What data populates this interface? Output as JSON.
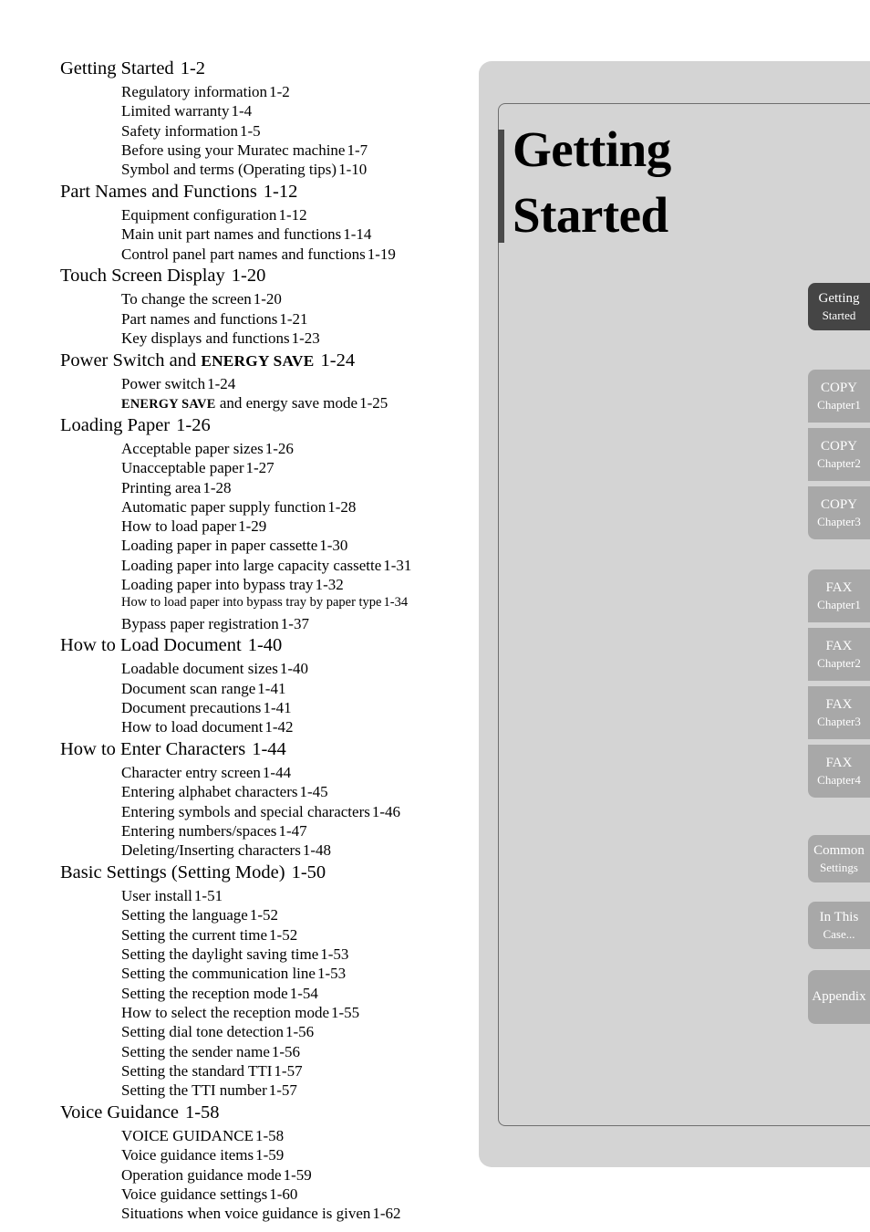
{
  "chapter": {
    "title_line1": "Getting",
    "title_line2": "Started",
    "accent_color": "#4a4a4a",
    "panel_color": "#d4d4d4"
  },
  "tabs": {
    "active_color": "#454545",
    "normal_color": "#a8a8a8",
    "groups": [
      {
        "name": "getting-started",
        "items": [
          {
            "main": "Getting",
            "sub": "Started",
            "active": true
          }
        ]
      },
      {
        "name": "copy",
        "items": [
          {
            "main": "COPY",
            "sub": "Chapter1",
            "active": false
          },
          {
            "main": "COPY",
            "sub": "Chapter2",
            "active": false
          },
          {
            "main": "COPY",
            "sub": "Chapter3",
            "active": false
          }
        ]
      },
      {
        "name": "fax",
        "items": [
          {
            "main": "FAX",
            "sub": "Chapter1",
            "active": false
          },
          {
            "main": "FAX",
            "sub": "Chapter2",
            "active": false
          },
          {
            "main": "FAX",
            "sub": "Chapter3",
            "active": false
          },
          {
            "main": "FAX",
            "sub": "Chapter4",
            "active": false
          }
        ]
      },
      {
        "name": "common-settings",
        "items": [
          {
            "main": "Common",
            "sub": "Settings",
            "active": false
          }
        ]
      },
      {
        "name": "in-this-case",
        "items": [
          {
            "main": "In This",
            "sub": "Case...",
            "active": false
          }
        ]
      },
      {
        "name": "appendix",
        "items": [
          {
            "main": "Appendix",
            "sub": "",
            "active": false
          }
        ]
      }
    ]
  },
  "toc": {
    "entries": [
      {
        "level": 1,
        "label": "Getting Started",
        "page": "1-2"
      },
      {
        "level": 2,
        "label": "Regulatory information",
        "page": "1-2"
      },
      {
        "level": 2,
        "label": "Limited warranty",
        "page": "1-4"
      },
      {
        "level": 2,
        "label": "Safety information",
        "page": "1-5"
      },
      {
        "level": 2,
        "label": "Before using your Muratec machine",
        "page": "1-7"
      },
      {
        "level": 2,
        "label": "Symbol and terms (Operating tips)",
        "page": "1-10"
      },
      {
        "level": 1,
        "label": "Part Names and Functions",
        "page": "1-12"
      },
      {
        "level": 2,
        "label": "Equipment configuration",
        "page": "1-12"
      },
      {
        "level": 2,
        "label": "Main unit part names and functions",
        "page": "1-14"
      },
      {
        "level": 2,
        "label": "Control panel part names and functions",
        "page": "1-19"
      },
      {
        "level": 1,
        "label": "Touch Screen Display",
        "page": "1-20"
      },
      {
        "level": 2,
        "label": "To change the screen",
        "page": "1-20"
      },
      {
        "level": 2,
        "label": "Part names and functions",
        "page": "1-21"
      },
      {
        "level": 2,
        "label": "Key displays and functions",
        "page": "1-23"
      },
      {
        "level": 1,
        "label": "Power Switch and ",
        "label_sc": "ENERGY SAVE",
        "page": "1-24"
      },
      {
        "level": 2,
        "label": "Power switch",
        "page": "1-24"
      },
      {
        "level": 2,
        "label_sc_first": "ENERGY SAVE",
        "label": " and energy save mode",
        "page": "1-25"
      },
      {
        "level": 1,
        "label": "Loading Paper",
        "page": "1-26"
      },
      {
        "level": 2,
        "label": "Acceptable paper sizes",
        "page": "1-26"
      },
      {
        "level": 2,
        "label": "Unacceptable paper",
        "page": "1-27"
      },
      {
        "level": 2,
        "label": "Printing area",
        "page": "1-28"
      },
      {
        "level": 2,
        "label": "Automatic paper supply function",
        "page": "1-28"
      },
      {
        "level": 2,
        "label": "How to load paper",
        "page": "1-29"
      },
      {
        "level": 2,
        "label": "Loading paper in paper cassette",
        "page": "1-30"
      },
      {
        "level": 2,
        "label": "Loading paper into large capacity cassette",
        "page": "1-31"
      },
      {
        "level": 2,
        "label": "Loading paper into bypass tray",
        "page": "1-32"
      },
      {
        "level": 2,
        "small": true,
        "label": "How to load paper into bypass tray by paper type",
        "page": "1-34"
      },
      {
        "level": 2,
        "label": "Bypass paper registration",
        "page": "1-37"
      },
      {
        "level": 1,
        "label": "How to Load Document",
        "page": "1-40"
      },
      {
        "level": 2,
        "label": "Loadable document sizes",
        "page": "1-40"
      },
      {
        "level": 2,
        "label": "Document scan range",
        "page": "1-41"
      },
      {
        "level": 2,
        "label": "Document precautions",
        "page": "1-41"
      },
      {
        "level": 2,
        "label": "How to load document",
        "page": "1-42"
      },
      {
        "level": 1,
        "label": "How to Enter Characters",
        "page": "1-44"
      },
      {
        "level": 2,
        "label": "Character entry screen",
        "page": "1-44"
      },
      {
        "level": 2,
        "label": "Entering alphabet characters",
        "page": "1-45"
      },
      {
        "level": 2,
        "label": "Entering symbols and special characters",
        "page": "1-46"
      },
      {
        "level": 2,
        "label": "Entering numbers/spaces",
        "page": "1-47"
      },
      {
        "level": 2,
        "label": "Deleting/Inserting characters",
        "page": "1-48"
      },
      {
        "level": 1,
        "label": "Basic Settings (Setting Mode)",
        "page": "1-50"
      },
      {
        "level": 2,
        "label": "User install",
        "page": "1-51"
      },
      {
        "level": 2,
        "label": "Setting the language",
        "page": "1-52"
      },
      {
        "level": 2,
        "label": "Setting the current time",
        "page": "1-52"
      },
      {
        "level": 2,
        "label": "Setting the daylight saving time",
        "page": "1-53"
      },
      {
        "level": 2,
        "label": "Setting the communication line",
        "page": "1-53"
      },
      {
        "level": 2,
        "label": "Setting the reception mode",
        "page": "1-54"
      },
      {
        "level": 2,
        "label": "How to select the reception mode",
        "page": "1-55"
      },
      {
        "level": 2,
        "label": "Setting dial tone detection",
        "page": "1-56"
      },
      {
        "level": 2,
        "label": "Setting the sender name",
        "page": "1-56"
      },
      {
        "level": 2,
        "label": "Setting the standard TTI",
        "page": "1-57"
      },
      {
        "level": 2,
        "label": "Setting the TTI number",
        "page": "1-57"
      },
      {
        "level": 1,
        "label": "Voice Guidance",
        "page": "1-58"
      },
      {
        "level": 2,
        "label": "VOICE GUIDANCE",
        "page": "1-58"
      },
      {
        "level": 2,
        "label": "Voice guidance items",
        "page": "1-59"
      },
      {
        "level": 2,
        "label": "Operation guidance mode",
        "page": "1-59"
      },
      {
        "level": 2,
        "label": "Voice guidance settings",
        "page": "1-60"
      },
      {
        "level": 2,
        "label": "Situations when voice guidance is given",
        "page": "1-62"
      }
    ]
  }
}
